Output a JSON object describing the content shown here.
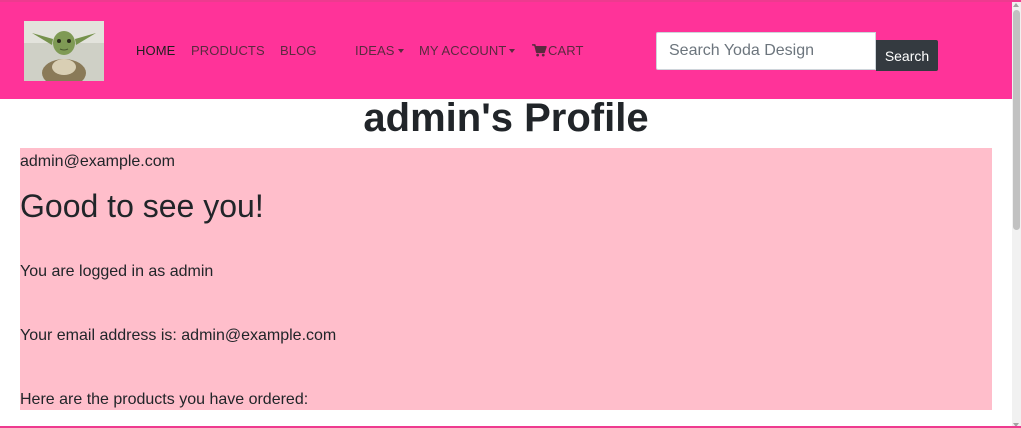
{
  "nav": {
    "links": [
      {
        "label": "HOME"
      },
      {
        "label": "PRODUCTS"
      },
      {
        "label": "BLOG"
      },
      {
        "label": "IDEAS"
      },
      {
        "label": "MY ACCOUNT"
      },
      {
        "label": "CART"
      }
    ],
    "logo_icon": "yoda-logo"
  },
  "search": {
    "placeholder": "Search Yoda Design",
    "button_label": "Search"
  },
  "page": {
    "title": "admin's Profile"
  },
  "profile": {
    "email_header": "admin@example.com",
    "greeting": "Good to see you!",
    "logged_in_text": "You are logged in as admin",
    "email_text": "Your email address is: admin@example.com",
    "orders_text": "Here are the products you have ordered:"
  },
  "colors": {
    "navbar_bg": "#ff3399",
    "panel_bg": "#ffbecb",
    "search_button_bg": "#343a40"
  }
}
